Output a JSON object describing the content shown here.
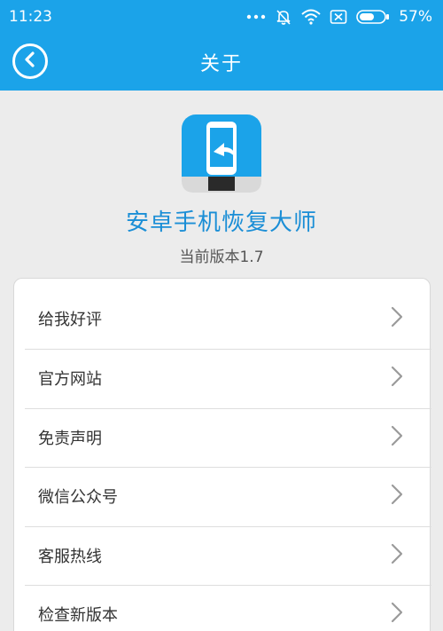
{
  "status": {
    "time": "11:23",
    "battery": "57%",
    "battery_level": 0.57
  },
  "nav": {
    "title": "关于",
    "back_icon": "chevron-left-icon"
  },
  "app": {
    "name": "安卓手机恢复大师",
    "version": "当前版本1.7",
    "icon": "phone-restore-icon"
  },
  "menu": {
    "items": [
      {
        "label": "给我好评"
      },
      {
        "label": "官方网站"
      },
      {
        "label": "免责声明"
      },
      {
        "label": "微信公众号"
      },
      {
        "label": "客服热线"
      },
      {
        "label": "检查新版本"
      }
    ]
  },
  "colors": {
    "accent": "#1ba3e9",
    "app_name": "#1a8ed6",
    "background": "#ececec"
  }
}
